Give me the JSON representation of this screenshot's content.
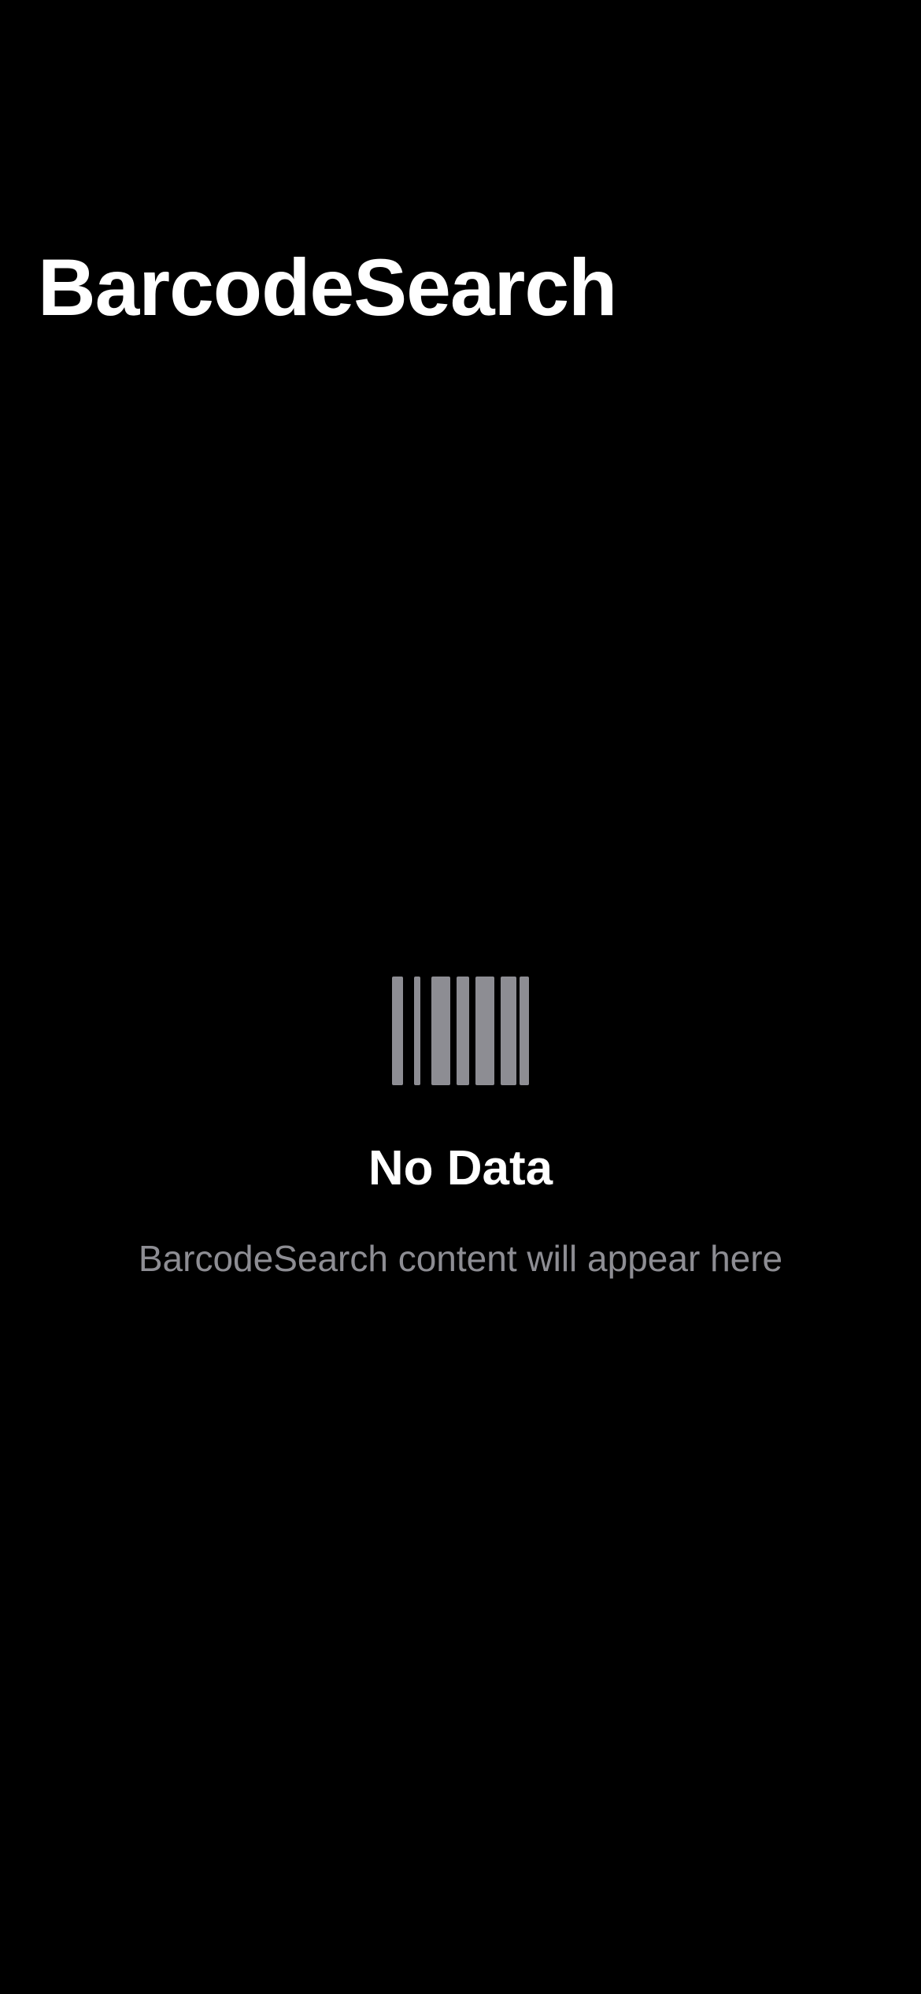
{
  "nav": {
    "title": "BarcodeSearch"
  },
  "empty_state": {
    "icon": "barcode-icon",
    "title": "No Data",
    "subtitle": "BarcodeSearch content will appear here"
  },
  "colors": {
    "background": "#000000",
    "primary_text": "#ffffff",
    "secondary_text": "#8d8d93",
    "icon_fill": "#8d8d93"
  }
}
